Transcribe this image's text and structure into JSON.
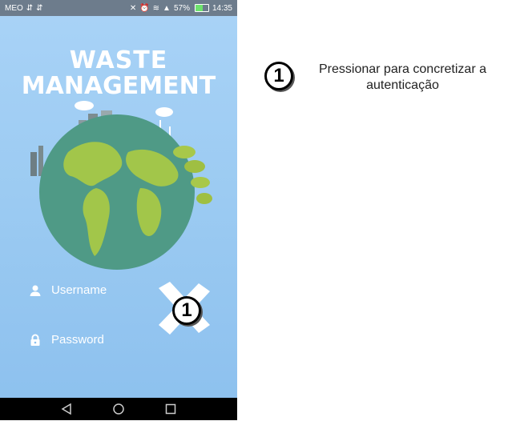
{
  "statusbar": {
    "carrier": "MEO",
    "battery": "57%",
    "battery_level": 0.57,
    "time": "14:35",
    "icons": [
      "usb-icon",
      "usb-icon",
      "mute-icon",
      "alarm-icon",
      "wifi-icon",
      "signal-icon",
      "battery-icon"
    ]
  },
  "app": {
    "logo_line1": "WASTE",
    "logo_line2": "MANAGEMENT",
    "username_placeholder": "Username",
    "password_placeholder": "Password",
    "login_icon": "x-cross-icon"
  },
  "annotation": {
    "number": "1",
    "text": "Pressionar para concretizar a autenticação"
  },
  "navbar": {
    "icons": [
      "back-icon",
      "home-icon",
      "recents-icon"
    ]
  }
}
